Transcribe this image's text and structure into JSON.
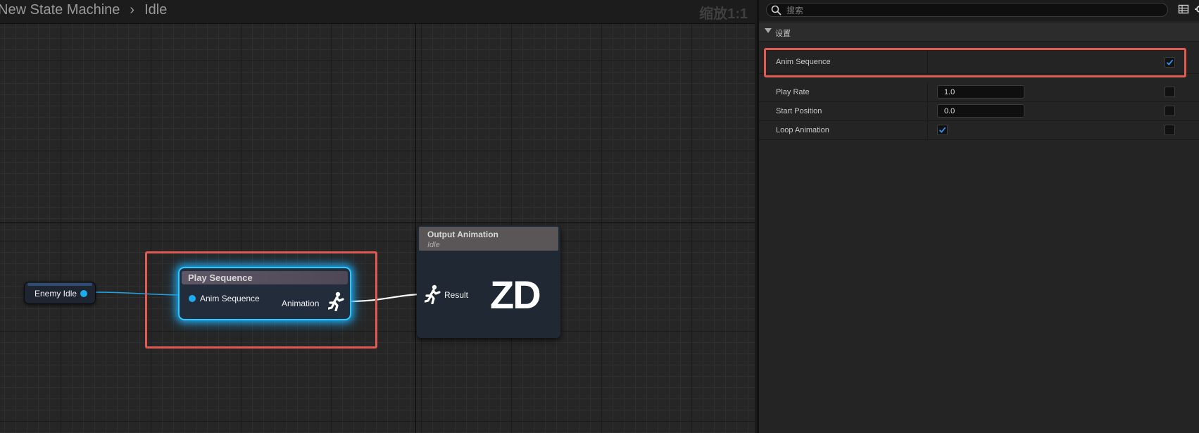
{
  "breadcrumb": {
    "parent": "New State Machine",
    "current": "Idle"
  },
  "graph": {
    "zoom_label": "缩放1:1",
    "nodes": {
      "enemy_idle": {
        "label": "Enemy Idle"
      },
      "play_sequence": {
        "title": "Play Sequence",
        "input_pin": "Anim Sequence",
        "output_pin": "Animation"
      },
      "output_animation": {
        "title": "Output Animation",
        "subtitle": "Idle",
        "result_pin": "Result",
        "logo": "ZD"
      }
    }
  },
  "details": {
    "search_placeholder": "搜索",
    "section_title": "设置",
    "properties": [
      {
        "name": "Anim Sequence",
        "type": "pin-checkbox",
        "checked": true
      },
      {
        "name": "Play Rate",
        "type": "number",
        "value": "1.0",
        "pin_checked": false
      },
      {
        "name": "Start Position",
        "type": "number",
        "value": "0.0",
        "pin_checked": false
      },
      {
        "name": "Loop Animation",
        "type": "bool",
        "value": true,
        "pin_checked": false
      }
    ]
  },
  "icons": [
    "search-icon",
    "grid-view-icon",
    "settings-icon",
    "running-figure-icon",
    "collapse-arrow-icon"
  ],
  "colors": {
    "highlight": "#e35a52",
    "selection_glow": "#2cc8ff",
    "pin_blue": "#1eaaf0",
    "checkbox_check": "#2a93f5"
  }
}
